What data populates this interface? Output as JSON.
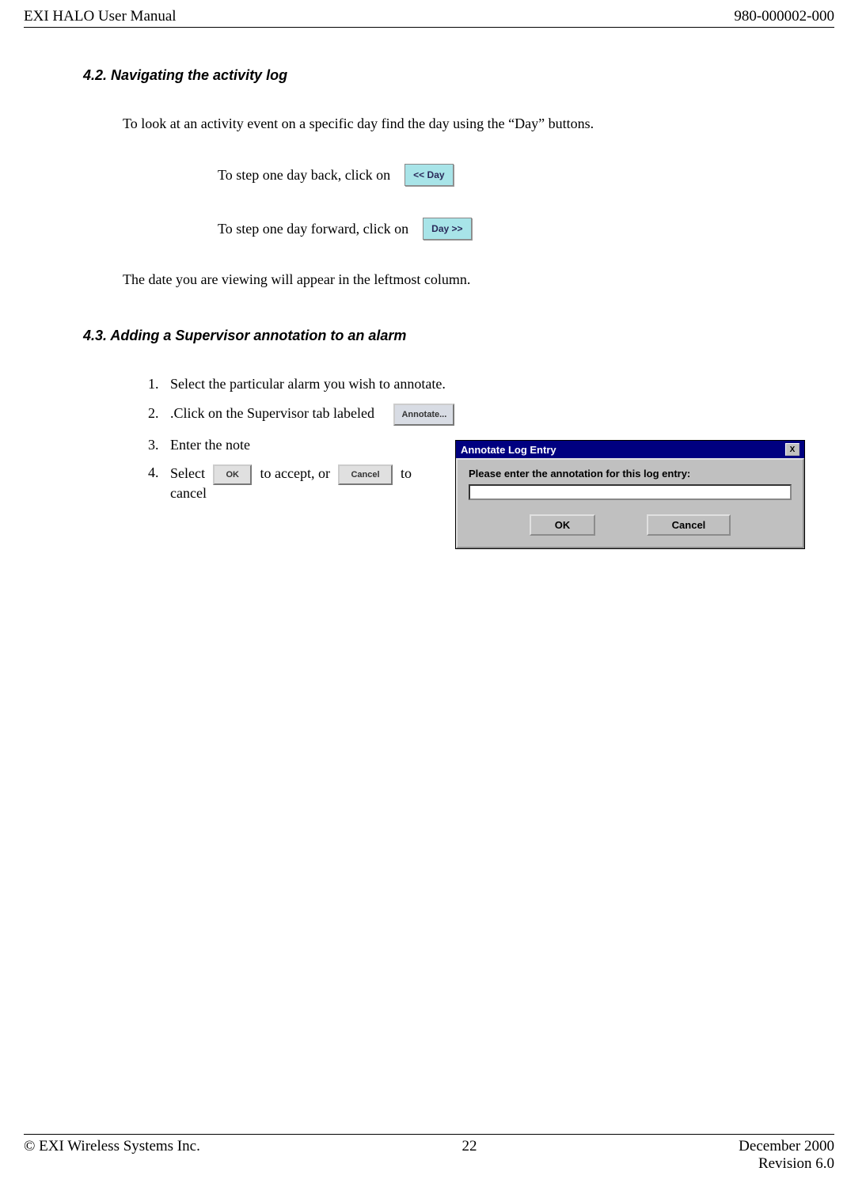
{
  "header": {
    "left": "EXI HALO User Manual",
    "right": "980-000002-000"
  },
  "section42": {
    "heading": "4.2.   Navigating the activity log",
    "intro": "To look at an activity event on a specific day find the day using the  “Day” buttons.",
    "back_text": "To step one day back, click on",
    "back_btn": "<< Day",
    "fwd_text": "To step one day forward, click on",
    "fwd_btn": "Day >>",
    "note": "The date you are viewing will appear in the leftmost column."
  },
  "section43": {
    "heading": "4.3.   Adding a Supervisor annotation to an alarm",
    "step1": "Select the particular alarm you wish to annotate.",
    "step2": ".Click on the Supervisor tab labeled",
    "annotate_btn": "Annotate...",
    "step3": "Enter the note",
    "step4_a": "Select",
    "ok_inline": "OK",
    "step4_b": "to accept, or",
    "cancel_inline": "Cancel",
    "step4_c": "to cancel"
  },
  "dialog": {
    "title": "Annotate Log Entry",
    "prompt": "Please enter the annotation for this log entry:",
    "ok": "OK",
    "cancel": "Cancel",
    "close": "X"
  },
  "footer": {
    "copyright": "© EXI Wireless Systems Inc.",
    "page": "22",
    "date": "December 2000",
    "revision": "Revision 6.0"
  }
}
